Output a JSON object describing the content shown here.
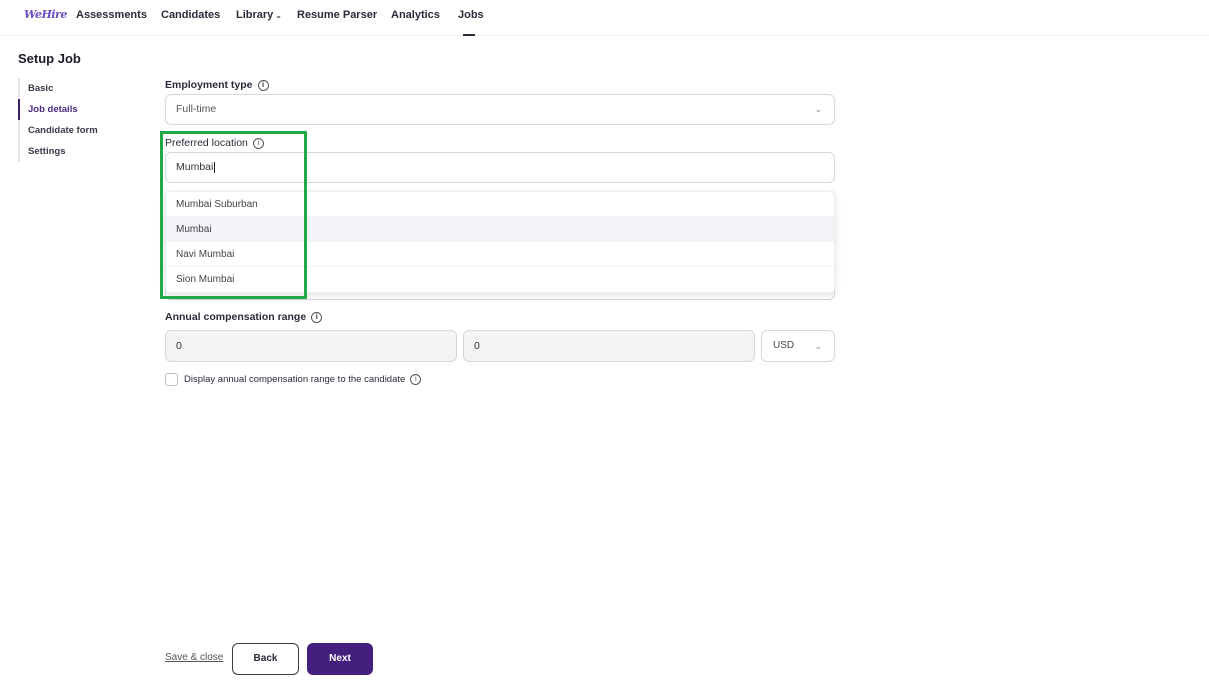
{
  "nav": {
    "logo_text": "WeHire",
    "items": [
      {
        "label": "Assessments"
      },
      {
        "label": "Candidates"
      },
      {
        "label": "Library"
      },
      {
        "label": "Resume Parser"
      },
      {
        "label": "Analytics"
      },
      {
        "label": "Jobs"
      }
    ]
  },
  "page": {
    "title": "Setup Job"
  },
  "steps": [
    {
      "label": "Basic"
    },
    {
      "label": "Job details",
      "active": true
    },
    {
      "label": "Candidate form"
    },
    {
      "label": "Settings"
    }
  ],
  "employment_type": {
    "label": "Employment type",
    "value": "Full-time"
  },
  "preferred_location": {
    "label": "Preferred location",
    "value": "Mumbai",
    "suggestions": [
      "Mumbai Suburban",
      "Mumbai",
      "Navi Mumbai",
      "Sion Mumbai"
    ],
    "hovered_index": 1
  },
  "compensation": {
    "label": "Annual compensation range",
    "min": "0",
    "max": "0",
    "currency": "USD",
    "display_label": "Display annual compensation range to the candidate"
  },
  "footer": {
    "save_close": "Save & close",
    "back": "Back",
    "next": "Next"
  },
  "colors": {
    "primary": "#43207e",
    "highlight": "#22a845"
  },
  "icons": {
    "info": "info-icon",
    "chevron": "chevron-down-icon"
  }
}
